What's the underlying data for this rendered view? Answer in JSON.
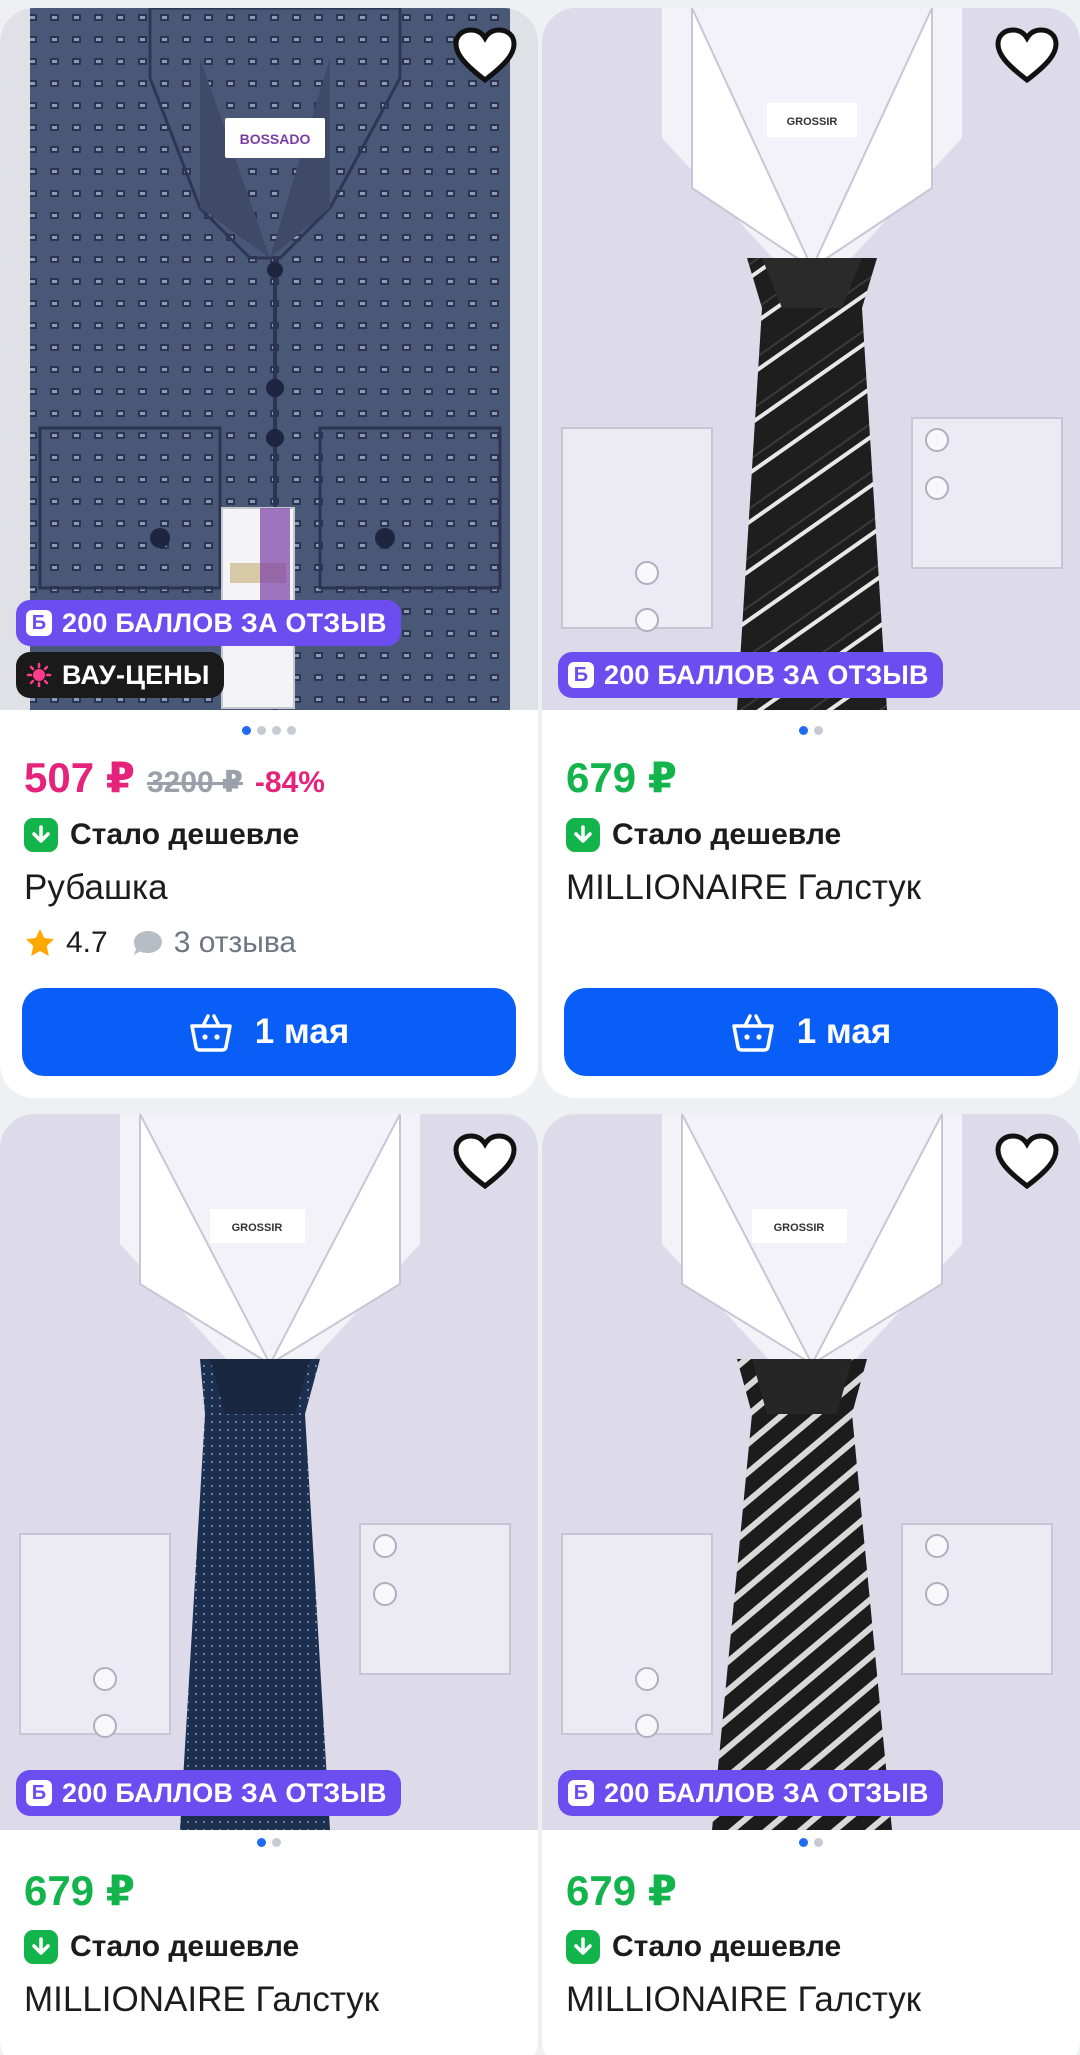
{
  "products": [
    {
      "badges": {
        "points": "200 БАЛЛОВ ЗА ОТЗЫВ",
        "points_icon": "Б",
        "wow": "ВАУ-ЦЕНЫ"
      },
      "price": "507 ₽",
      "old_price": "3200 ₽",
      "discount": "-84%",
      "cheaper": "Стало дешевле",
      "title": "Рубашка",
      "rating": "4.7",
      "reviews": "3 отзыва",
      "button": "1 мая",
      "photo_count": 4,
      "photo_active": 1,
      "label_brand": "BOSSADO"
    },
    {
      "badges": {
        "points": "200 БАЛЛОВ ЗА ОТЗЫВ",
        "points_icon": "Б"
      },
      "price": "679 ₽",
      "cheaper": "Стало дешевле",
      "title": "MILLIONAIRE Галстук",
      "button": "1 мая",
      "photo_count": 2,
      "photo_active": 1,
      "label_brand": "GROSSIR"
    },
    {
      "badges": {
        "points": "200 БАЛЛОВ ЗА ОТЗЫВ",
        "points_icon": "Б"
      },
      "price": "679 ₽",
      "cheaper": "Стало дешевле",
      "title": "MILLIONAIRE Галстук",
      "photo_count": 2,
      "photo_active": 1,
      "label_brand": "GROSSIR"
    },
    {
      "badges": {
        "points": "200 БАЛЛОВ ЗА ОТЗЫВ",
        "points_icon": "Б"
      },
      "price": "679 ₽",
      "cheaper": "Стало дешевле",
      "title": "MILLIONAIRE Галстук",
      "photo_count": 2,
      "photo_active": 1,
      "label_brand": "GROSSIR"
    }
  ],
  "colors": {
    "price_sale": "#e6237b",
    "price_regular": "#13b44c",
    "points_badge": "#6c4df0",
    "cart_button": "#0a5ef8"
  },
  "icons": {
    "favorite": "heart-outline-icon",
    "cheaper": "arrow-down-icon",
    "rating": "star-icon",
    "reviews": "speech-bubble-icon",
    "cart": "basket-icon",
    "wow": "sun-icon"
  }
}
